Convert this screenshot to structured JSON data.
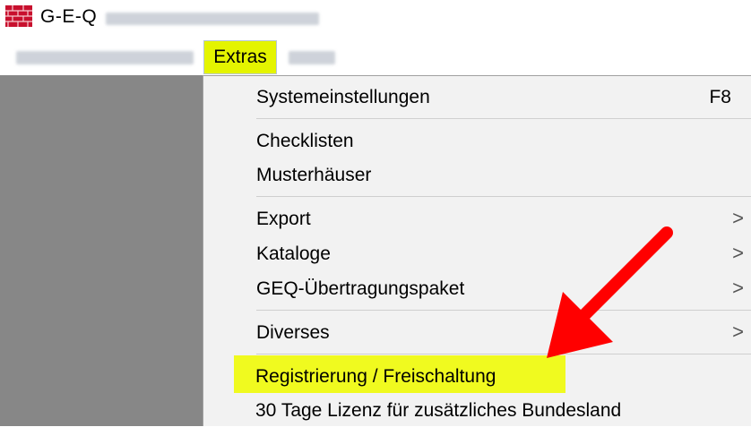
{
  "window": {
    "title": "G-E-Q",
    "icon": "brick-wall-icon"
  },
  "menubar": {
    "items": [
      "Extras"
    ]
  },
  "menu": {
    "items": {
      "systemeinstellungen": {
        "label": "Systemeinstellungen",
        "shortcut": "F8"
      },
      "checklisten": {
        "label": "Checklisten"
      },
      "musterhaeuser": {
        "label": "Musterhäuser"
      },
      "export": {
        "label": "Export",
        "submenu_icon": ">"
      },
      "kataloge": {
        "label": "Kataloge",
        "submenu_icon": ">"
      },
      "uebertragungspaket": {
        "label": "GEQ-Übertragungspaket",
        "submenu_icon": ">"
      },
      "diverses": {
        "label": "Diverses",
        "submenu_icon": ">"
      },
      "registrierung": {
        "label": "Registrierung / Freischaltung",
        "highlighted": true
      },
      "lizenz": {
        "label": "30 Tage Lizenz für zusätzliches Bundesland"
      }
    }
  },
  "colors": {
    "highlight": "#f0fa1f",
    "menu_bg": "#f2f2f2",
    "left_pane": "#878787",
    "arrow": "#ff0000"
  }
}
